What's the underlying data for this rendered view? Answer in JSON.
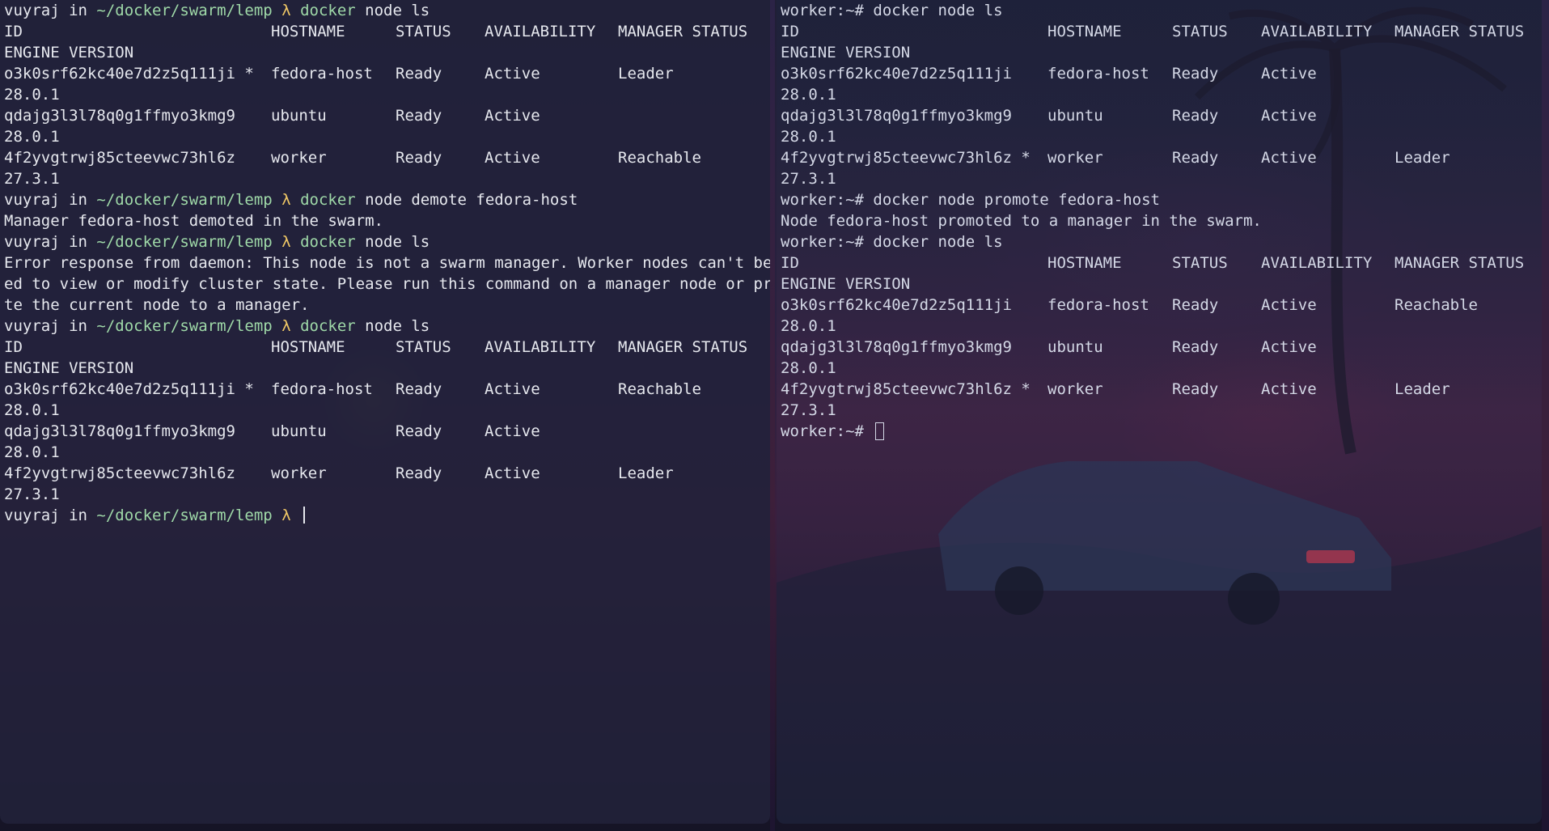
{
  "left_terminal": {
    "lines": [
      {
        "type": "prompt",
        "user": "vuyraj",
        "in": " in ",
        "path": "~/docker/swarm/lemp",
        "lambda": " λ ",
        "command": "docker",
        "args": " node ls"
      },
      {
        "type": "table",
        "id": "ID",
        "host": "HOSTNAME",
        "status": "STATUS",
        "avail": "AVAILABILITY",
        "mgr": "MANAGER STATUS"
      },
      {
        "type": "text",
        "text": "ENGINE VERSION"
      },
      {
        "type": "table",
        "id": "o3k0srf62kc40e7d2z5q111ji *",
        "host": "fedora-host",
        "status": "Ready",
        "avail": "Active",
        "mgr": "Leader"
      },
      {
        "type": "text",
        "text": "28.0.1"
      },
      {
        "type": "table",
        "id": "qdajg3l3l78q0g1ffmyo3kmg9",
        "host": "ubuntu",
        "status": "Ready",
        "avail": "Active",
        "mgr": ""
      },
      {
        "type": "text",
        "text": "28.0.1"
      },
      {
        "type": "table",
        "id": "4f2yvgtrwj85cteevwc73hl6z",
        "host": "worker",
        "status": "Ready",
        "avail": "Active",
        "mgr": "Reachable"
      },
      {
        "type": "text",
        "text": "27.3.1"
      },
      {
        "type": "prompt",
        "user": "vuyraj",
        "in": " in ",
        "path": "~/docker/swarm/lemp",
        "lambda": " λ ",
        "command": "docker",
        "args": " node demote fedora-host"
      },
      {
        "type": "text",
        "text": "Manager fedora-host demoted in the swarm."
      },
      {
        "type": "prompt",
        "user": "vuyraj",
        "in": " in ",
        "path": "~/docker/swarm/lemp",
        "lambda": " λ ",
        "command": "docker",
        "args": " node ls"
      },
      {
        "type": "text",
        "text": "Error response from daemon: This node is not a swarm manager. Worker nodes can't be us"
      },
      {
        "type": "text",
        "text": "ed to view or modify cluster state. Please run this command on a manager node or promo"
      },
      {
        "type": "text",
        "text": "te the current node to a manager."
      },
      {
        "type": "prompt",
        "user": "vuyraj",
        "in": " in ",
        "path": "~/docker/swarm/lemp",
        "lambda": " λ ",
        "command": "docker",
        "args": " node ls"
      },
      {
        "type": "table",
        "id": "ID",
        "host": "HOSTNAME",
        "status": "STATUS",
        "avail": "AVAILABILITY",
        "mgr": "MANAGER STATUS"
      },
      {
        "type": "text",
        "text": "ENGINE VERSION"
      },
      {
        "type": "table",
        "id": "o3k0srf62kc40e7d2z5q111ji *",
        "host": "fedora-host",
        "status": "Ready",
        "avail": "Active",
        "mgr": "Reachable"
      },
      {
        "type": "text",
        "text": "28.0.1"
      },
      {
        "type": "table",
        "id": "qdajg3l3l78q0g1ffmyo3kmg9",
        "host": "ubuntu",
        "status": "Ready",
        "avail": "Active",
        "mgr": ""
      },
      {
        "type": "text",
        "text": "28.0.1"
      },
      {
        "type": "table",
        "id": "4f2yvgtrwj85cteevwc73hl6z",
        "host": "worker",
        "status": "Ready",
        "avail": "Active",
        "mgr": "Leader"
      },
      {
        "type": "text",
        "text": "27.3.1"
      },
      {
        "type": "prompt_active",
        "user": "vuyraj",
        "in": " in ",
        "path": "~/docker/swarm/lemp",
        "lambda": " λ "
      }
    ]
  },
  "right_terminal": {
    "lines": [
      {
        "type": "text",
        "text": "worker:~# docker node ls"
      },
      {
        "type": "table",
        "id": "ID",
        "host": "HOSTNAME",
        "status": "STATUS",
        "avail": "AVAILABILITY",
        "mgr": "MANAGER STATUS"
      },
      {
        "type": "text",
        "text": "ENGINE VERSION"
      },
      {
        "type": "table",
        "id": "o3k0srf62kc40e7d2z5q111ji",
        "host": "fedora-host",
        "status": "Ready",
        "avail": "Active",
        "mgr": ""
      },
      {
        "type": "text",
        "text": "28.0.1"
      },
      {
        "type": "table",
        "id": "qdajg3l3l78q0g1ffmyo3kmg9",
        "host": "ubuntu",
        "status": "Ready",
        "avail": "Active",
        "mgr": ""
      },
      {
        "type": "text",
        "text": "28.0.1"
      },
      {
        "type": "table",
        "id": "4f2yvgtrwj85cteevwc73hl6z *",
        "host": "worker",
        "status": "Ready",
        "avail": "Active",
        "mgr": "Leader"
      },
      {
        "type": "text",
        "text": "27.3.1"
      },
      {
        "type": "text",
        "text": "worker:~# docker node promote fedora-host"
      },
      {
        "type": "text",
        "text": "Node fedora-host promoted to a manager in the swarm."
      },
      {
        "type": "text",
        "text": "worker:~# docker node ls"
      },
      {
        "type": "table",
        "id": "ID",
        "host": "HOSTNAME",
        "status": "STATUS",
        "avail": "AVAILABILITY",
        "mgr": "MANAGER STATUS"
      },
      {
        "type": "text",
        "text": "ENGINE VERSION"
      },
      {
        "type": "table",
        "id": "o3k0srf62kc40e7d2z5q111ji",
        "host": "fedora-host",
        "status": "Ready",
        "avail": "Active",
        "mgr": "Reachable"
      },
      {
        "type": "text",
        "text": "28.0.1"
      },
      {
        "type": "table",
        "id": "qdajg3l3l78q0g1ffmyo3kmg9",
        "host": "ubuntu",
        "status": "Ready",
        "avail": "Active",
        "mgr": ""
      },
      {
        "type": "text",
        "text": "28.0.1"
      },
      {
        "type": "table",
        "id": "4f2yvgtrwj85cteevwc73hl6z *",
        "host": "worker",
        "status": "Ready",
        "avail": "Active",
        "mgr": "Leader"
      },
      {
        "type": "text",
        "text": "27.3.1"
      },
      {
        "type": "prompt_active_plain",
        "text": "worker:~# "
      }
    ]
  },
  "colors": {
    "prompt_path": "#9fd9a8",
    "prompt_lambda": "#f0c866",
    "command": "#9fd9a8",
    "text": "#e6e8ee"
  }
}
